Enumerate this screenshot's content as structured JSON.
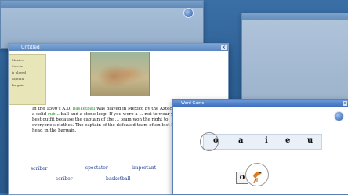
{
  "background_windows": [
    {
      "id": "bg-window-top-left"
    },
    {
      "id": "bg-window-right"
    }
  ],
  "main_window": {
    "title": "Untitled",
    "close_label": "x",
    "note_lines": [
      "Mexico",
      "Soccer",
      "is played",
      "captain",
      "bargain"
    ],
    "paragraph": [
      {
        "text": "In the 1500's A.D. "
      },
      {
        "text": "basketball",
        "highlight": true
      },
      {
        "text": " was played in Mexico by the Aztecs, using a solid "
      },
      {
        "text": "rub",
        "highlight": true
      },
      {
        "text": "... ball and a stone loop. If you were a ... not to wear your best outfit because the captain of the ... team won the right to everyone's clothes. The captain of the defeated team often lost his head in the bargain."
      }
    ],
    "words": [
      "scriber",
      "spectator",
      "important",
      "scriber",
      "basketball"
    ]
  },
  "game_window": {
    "title": "Word Game",
    "close_label": "x",
    "letters": [
      "o",
      "a",
      "i",
      "e",
      "u"
    ],
    "answer_letter": "o"
  },
  "colors": {
    "accent": "#3e6fbd",
    "highlight": "#1c9a1c",
    "word": "#1d3e8f"
  }
}
